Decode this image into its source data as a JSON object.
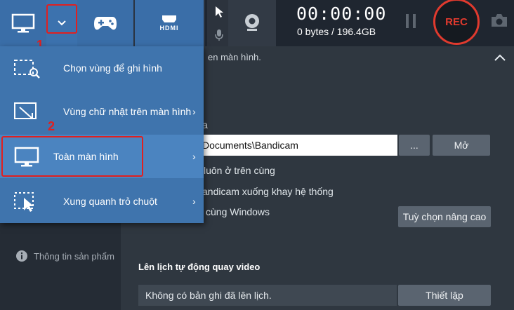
{
  "recorder": {
    "timer": "00:00:00",
    "storage": "0 bytes / 196.4GB",
    "rec_label": "REC",
    "hdmi_label": "HDMI"
  },
  "menu": {
    "items": [
      {
        "label": "Chọn vùng để ghi hình",
        "icon": "select-area-icon",
        "has_submenu": false
      },
      {
        "label": "Vùng chữ nhật trên màn hình",
        "icon": "rectangle-area-icon",
        "has_submenu": true
      },
      {
        "label": "Toàn màn hình",
        "icon": "monitor-icon",
        "has_submenu": true
      },
      {
        "label": "Xung quanh trỏ chuột",
        "icon": "around-cursor-icon",
        "has_submenu": true
      }
    ],
    "submenu_chevron": "›"
  },
  "annotations": {
    "step1": "1",
    "step2": "2",
    "color": "#e02020"
  },
  "panel": {
    "title_fragment": "en màn hình.",
    "folder_label_fragment": "a",
    "folder_path": "Documents\\Bandicam",
    "browse_label": "...",
    "open_label": "Mở",
    "options": [
      "luôn ở trên cùng",
      "andicam xuống khay hệ thống",
      "cùng Windows"
    ],
    "advanced_label": "Tuỳ chọn nâng cao",
    "schedule_title": "Lên lịch tự động quay video",
    "schedule_value": "Không có bản ghi đã lên lịch.",
    "schedule_button": "Thiết lập"
  },
  "sidebar": {
    "product_info": "Thông tin sản phẩm"
  },
  "colors": {
    "accent_blue": "#3f74ad",
    "rec_red": "#e03a2e"
  }
}
